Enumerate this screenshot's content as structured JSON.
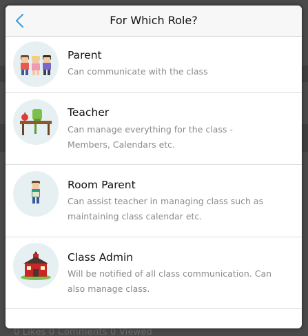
{
  "dialog": {
    "title": "For Which Role?",
    "back_icon": "chevron-left-icon",
    "accent_color": "#3b9bd4"
  },
  "roles": [
    {
      "name": "Parent",
      "description": "Can communicate with the class",
      "icon": "parents-icon"
    },
    {
      "name": "Teacher",
      "description": "Can manage everything for the class - Members, Calendars etc.",
      "icon": "teacher-desk-icon"
    },
    {
      "name": "Room Parent",
      "description": "Can assist teacher in managing class such as maintaining class calendar etc.",
      "icon": "room-parent-icon"
    },
    {
      "name": "Class Admin",
      "description": "Will be notified of all class communication. Can also manage class.",
      "icon": "schoolhouse-icon"
    }
  ],
  "background_footer": "0 Likes   0 Comments   0 Viewed"
}
